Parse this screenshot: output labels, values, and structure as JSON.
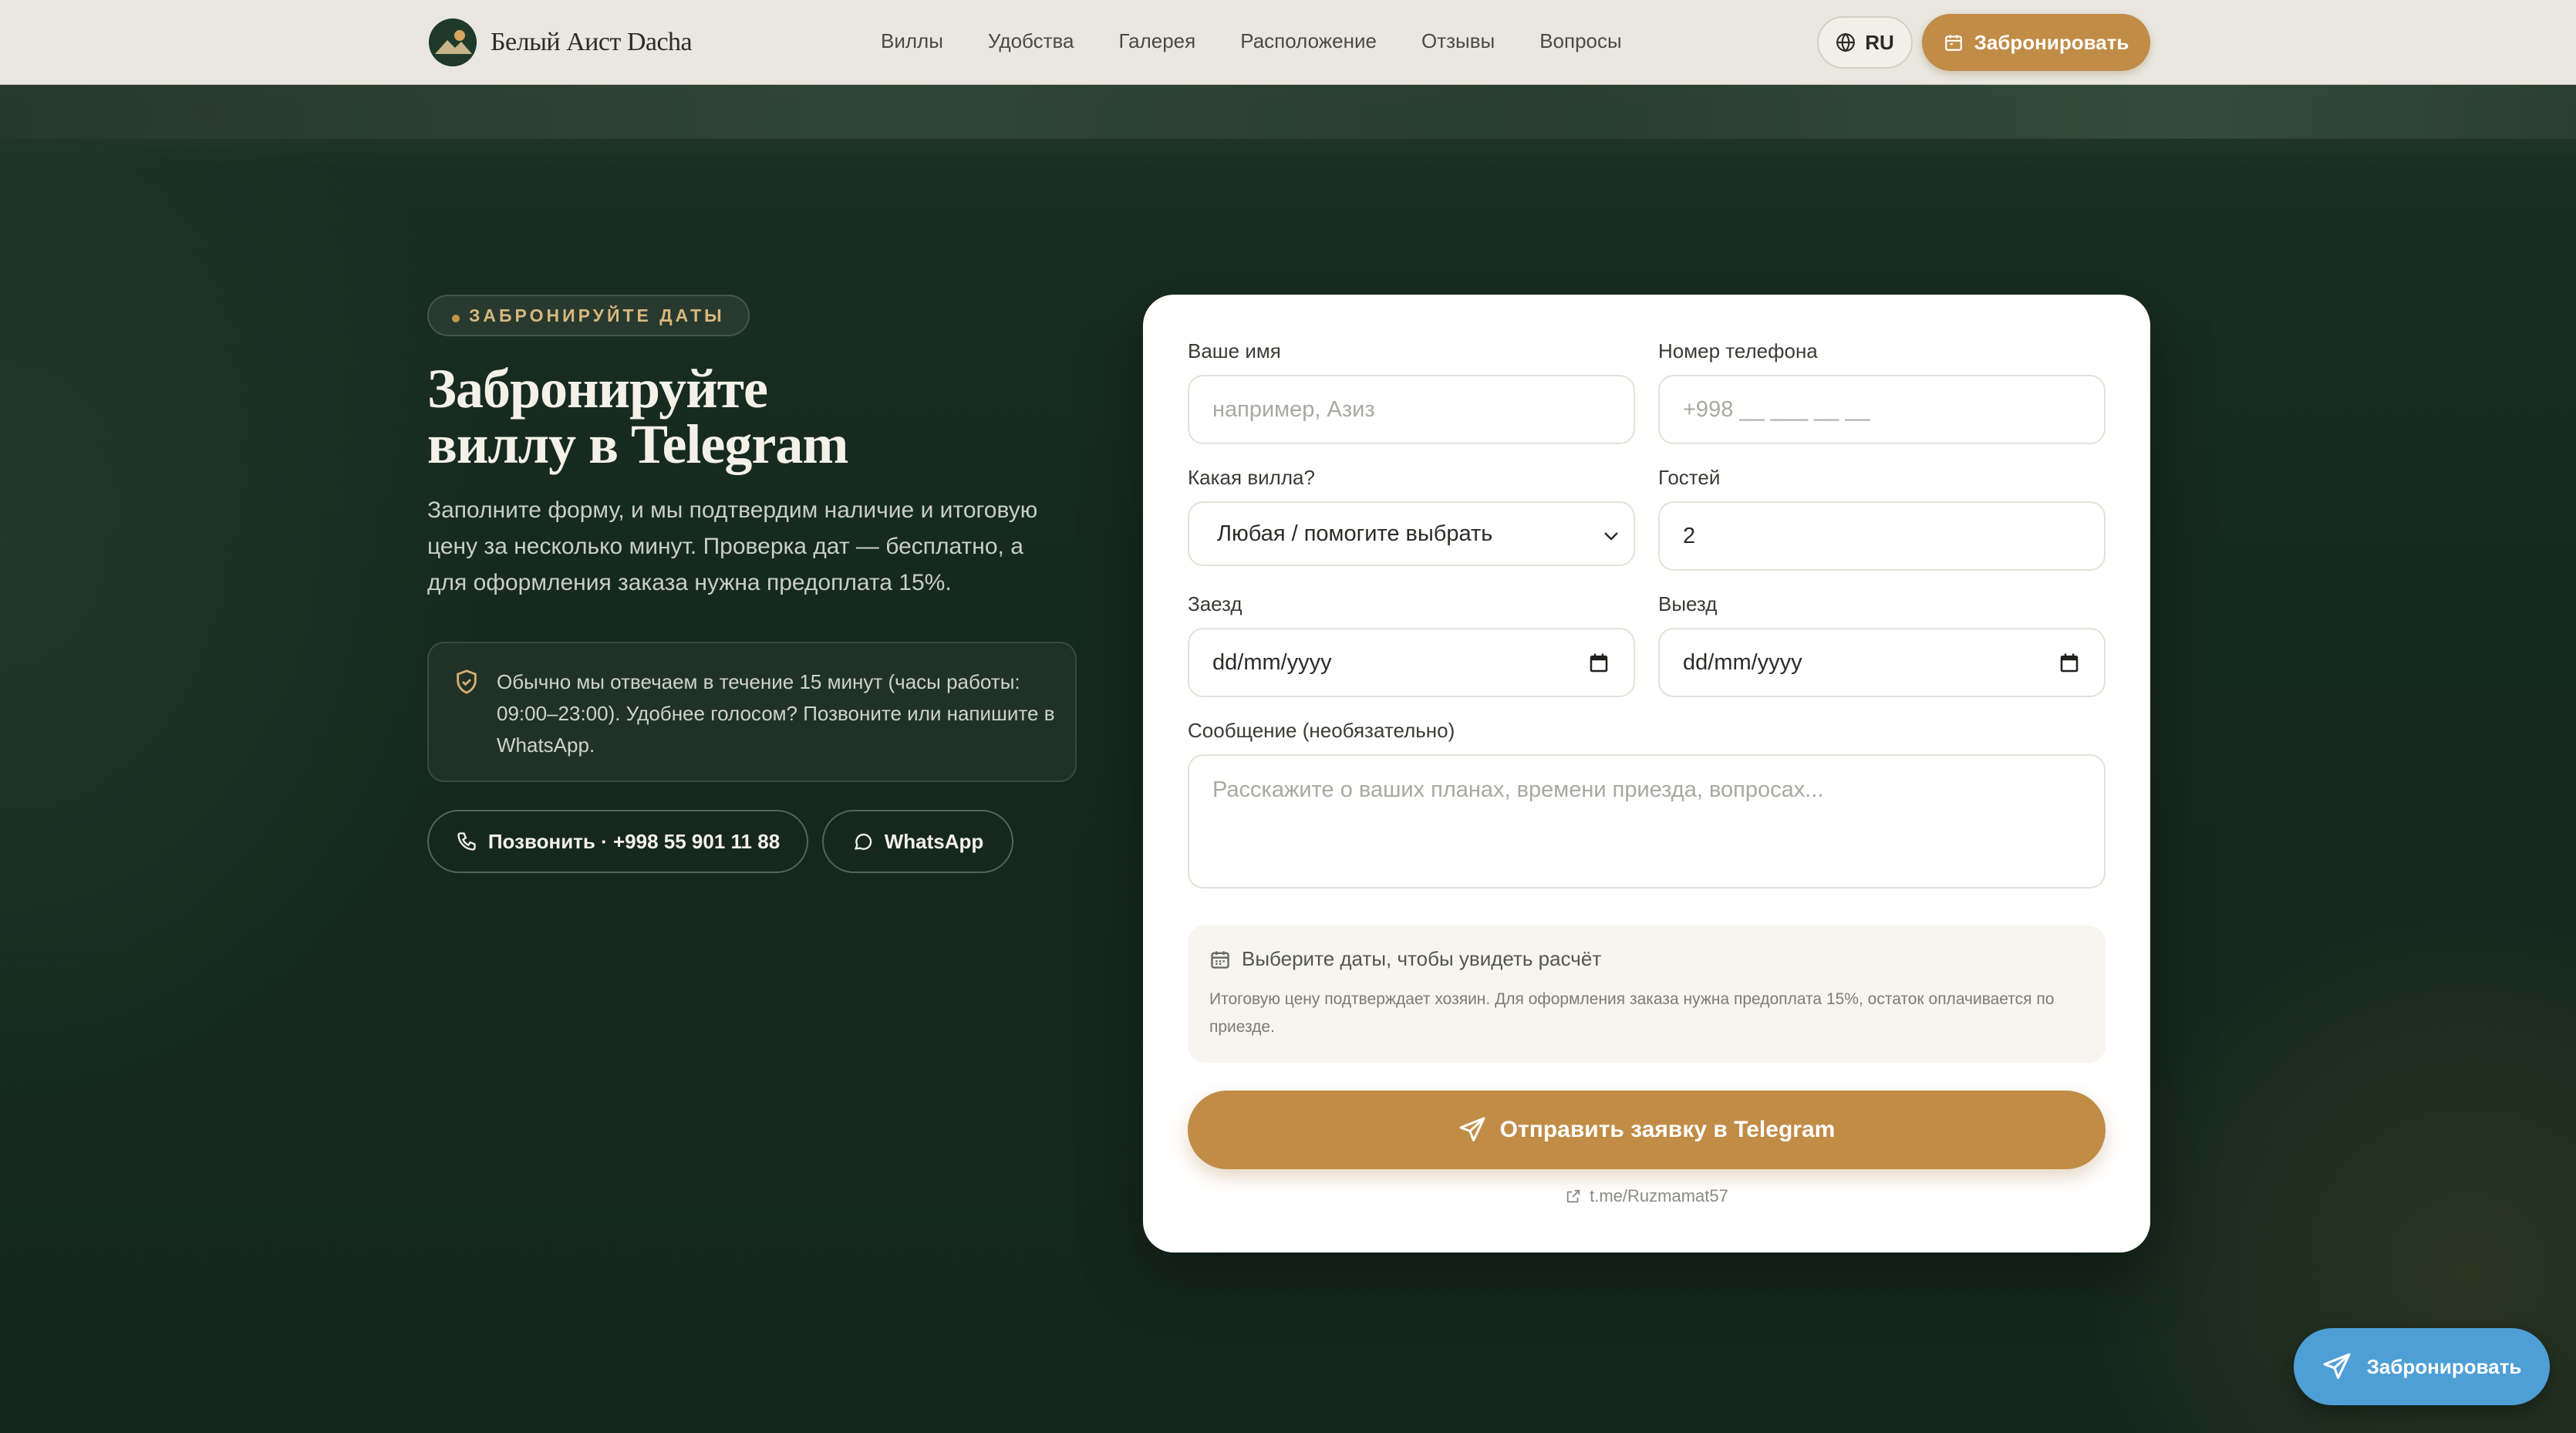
{
  "brand": {
    "name": "Белый Аист Dacha"
  },
  "nav": {
    "items": [
      "Виллы",
      "Удобства",
      "Галерея",
      "Расположение",
      "Отзывы",
      "Вопросы"
    ],
    "lang": "RU",
    "book_label": "Забронировать"
  },
  "hero": {
    "pill": "ЗАБРОНИРУЙТЕ ДАТЫ",
    "title_line1": "Забронируйте",
    "title_line2": "виллу в Telegram",
    "lede": "Заполните форму, и мы подтвердим наличие и итоговую цену за несколько минут. Проверка дат — бесплатно, а для оформления заказа нужна предоплата 15%.",
    "note": "Обычно мы отвечаем в течение 15 минут (часы работы: 09:00–23:00). Удобнее голосом? Позвоните или напишите в WhatsApp.",
    "call_label": "Позвонить · +998 55 901 11 88",
    "whatsapp_label": "WhatsApp"
  },
  "form": {
    "name": {
      "label": "Ваше имя",
      "placeholder": "например, Азиз"
    },
    "phone": {
      "label": "Номер телефона",
      "placeholder": "+998 __ ___ __ __"
    },
    "villa": {
      "label": "Какая вилла?",
      "value": "Любая / помогите выбрать"
    },
    "guests": {
      "label": "Гостей",
      "value": "2"
    },
    "checkin": {
      "label": "Заезд",
      "value": "dd/mm/yyyy"
    },
    "checkout": {
      "label": "Выезд",
      "value": "dd/mm/yyyy"
    },
    "message": {
      "label": "Сообщение (необязательно)",
      "placeholder": "Расскажите о ваших планах, времени приезда, вопросах..."
    },
    "calc_title": "Выберите даты, чтобы увидеть расчёт",
    "calc_note": "Итоговую цену подтверждает хозяин. Для оформления заказа нужна предоплата 15%, остаток оплачивается по приезде.",
    "submit_label": "Отправить заявку в Telegram",
    "telegram_link": "t.me/Ruzmamat57"
  },
  "floating": {
    "book_label": "Забронировать"
  },
  "colors": {
    "accent": "#c08c46",
    "background": "#16281e",
    "telegram": "#4e9fd6"
  }
}
